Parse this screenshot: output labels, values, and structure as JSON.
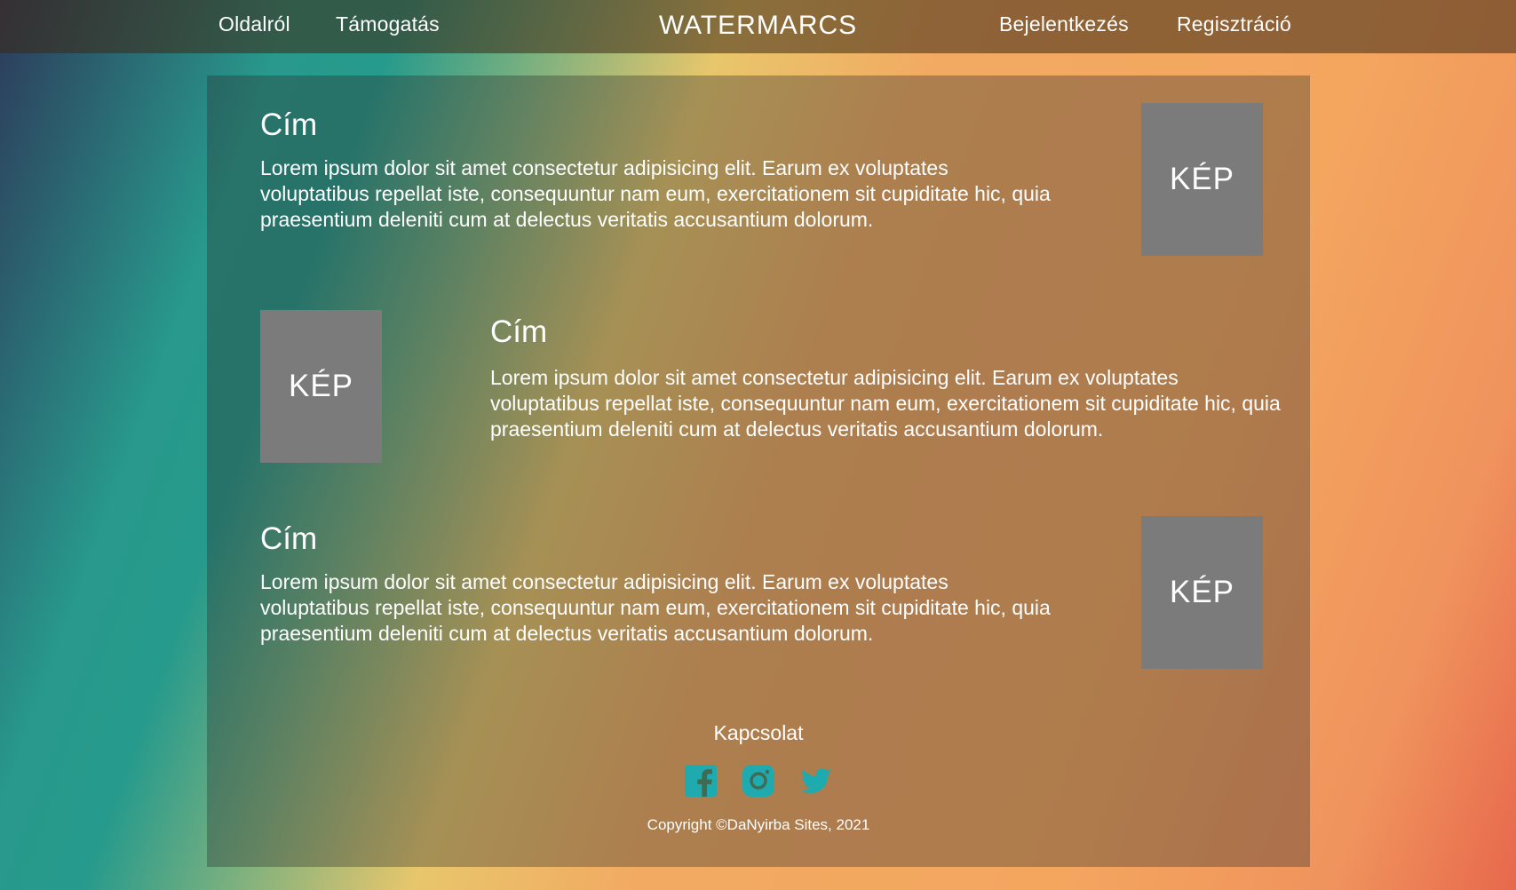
{
  "header": {
    "nav_left": [
      "Oldalról",
      "Támogatás"
    ],
    "brand": "WATERMARCS",
    "nav_right": [
      "Bejelentkezés",
      "Regisztráció"
    ]
  },
  "sections": [
    {
      "title": "Cím",
      "text": "Lorem ipsum dolor sit amet consectetur adipisicing elit. Earum ex voluptates voluptatibus repellat iste, consequuntur nam eum, exercitationem sit cupiditate hic, quia praesentium deleniti cum at delectus veritatis accusantium dolorum.",
      "image_label": "KÉP"
    },
    {
      "title": "Cím",
      "text": "Lorem ipsum dolor sit amet consectetur adipisicing elit. Earum ex voluptates voluptatibus repellat iste, consequuntur nam eum, exercitationem sit cupiditate hic, quia praesentium deleniti cum at delectus veritatis accusantium dolorum.",
      "image_label": "KÉP"
    },
    {
      "title": "Cím",
      "text": "Lorem ipsum dolor sit amet consectetur adipisicing elit. Earum ex voluptates voluptatibus repellat iste, consequuntur nam eum, exercitationem sit cupiditate hic, quia praesentium deleniti cum at delectus veritatis accusantium dolorum.",
      "image_label": "KÉP"
    }
  ],
  "footer": {
    "contact_label": "Kapcsolat",
    "social_icons": [
      "facebook-icon",
      "instagram-icon",
      "twitter-icon"
    ],
    "icon_color": "#1faab0",
    "copyright": "Copyright ©DaNyirba Sites, 2021"
  }
}
